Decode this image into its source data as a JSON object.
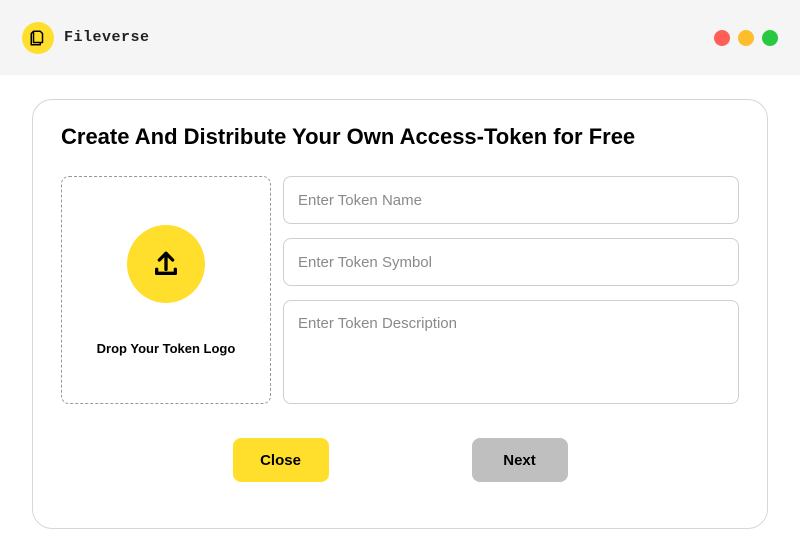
{
  "brand": {
    "name": "Fileverse"
  },
  "modal": {
    "title": "Create And Distribute Your Own Access-Token for Free",
    "dropzone": {
      "label": "Drop Your Token Logo"
    },
    "inputs": {
      "name_placeholder": "Enter Token Name",
      "symbol_placeholder": "Enter Token Symbol",
      "description_placeholder": "Enter Token Description"
    },
    "buttons": {
      "close": "Close",
      "next": "Next"
    }
  }
}
